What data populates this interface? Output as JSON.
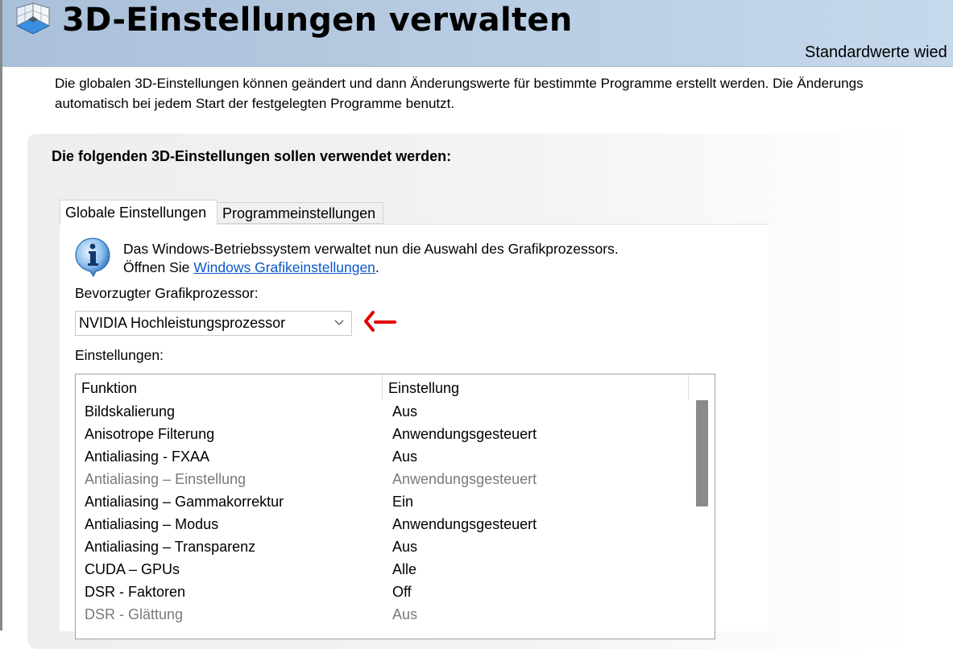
{
  "header": {
    "title": "3D-Einstellungen verwalten",
    "restore_defaults": "Standardwerte wied"
  },
  "intro": {
    "line1": "Die globalen 3D-Einstellungen können geändert und dann Änderungswerte für bestimmte Programme erstellt werden. Die Änderungs",
    "line2": "automatisch bei jedem Start der festgelegten Programme benutzt."
  },
  "section": {
    "title": "Die folgenden 3D-Einstellungen sollen verwendet werden:"
  },
  "tabs": [
    {
      "label": "Globale Einstellungen",
      "active": true
    },
    {
      "label": "Programmeinstellungen",
      "active": false
    }
  ],
  "info": {
    "line1": "Das Windows-Betriebssystem verwaltet nun die Auswahl des Grafikprozessors.",
    "line2_prefix": "Öffnen Sie ",
    "link": "Windows Grafikeinstellungen",
    "line2_suffix": "."
  },
  "gpu": {
    "label": "Bevorzugter Grafikprozessor:",
    "selected": "NVIDIA Hochleistungsprozessor"
  },
  "settings": {
    "label": "Einstellungen:",
    "columns": [
      "Funktion",
      "Einstellung"
    ],
    "rows": [
      {
        "function": "Bildskalierung",
        "value": "Aus",
        "disabled": false
      },
      {
        "function": "Anisotrope Filterung",
        "value": "Anwendungsgesteuert",
        "disabled": false
      },
      {
        "function": "Antialiasing - FXAA",
        "value": "Aus",
        "disabled": false
      },
      {
        "function": "Antialiasing – Einstellung",
        "value": "Anwendungsgesteuert",
        "disabled": true
      },
      {
        "function": "Antialiasing – Gammakorrektur",
        "value": "Ein",
        "disabled": false
      },
      {
        "function": "Antialiasing – Modus",
        "value": "Anwendungsgesteuert",
        "disabled": false
      },
      {
        "function": "Antialiasing – Transparenz",
        "value": "Aus",
        "disabled": false
      },
      {
        "function": "CUDA – GPUs",
        "value": "Alle",
        "disabled": false
      },
      {
        "function": "DSR - Faktoren",
        "value": "Off",
        "disabled": false
      },
      {
        "function": "DSR - Glättung",
        "value": "Aus",
        "disabled": true
      }
    ]
  },
  "colors": {
    "header_bg": "#b9cde3",
    "link": "#0a58c8",
    "annotation_arrow": "#e00000",
    "disabled_text": "#7a7a7a"
  }
}
